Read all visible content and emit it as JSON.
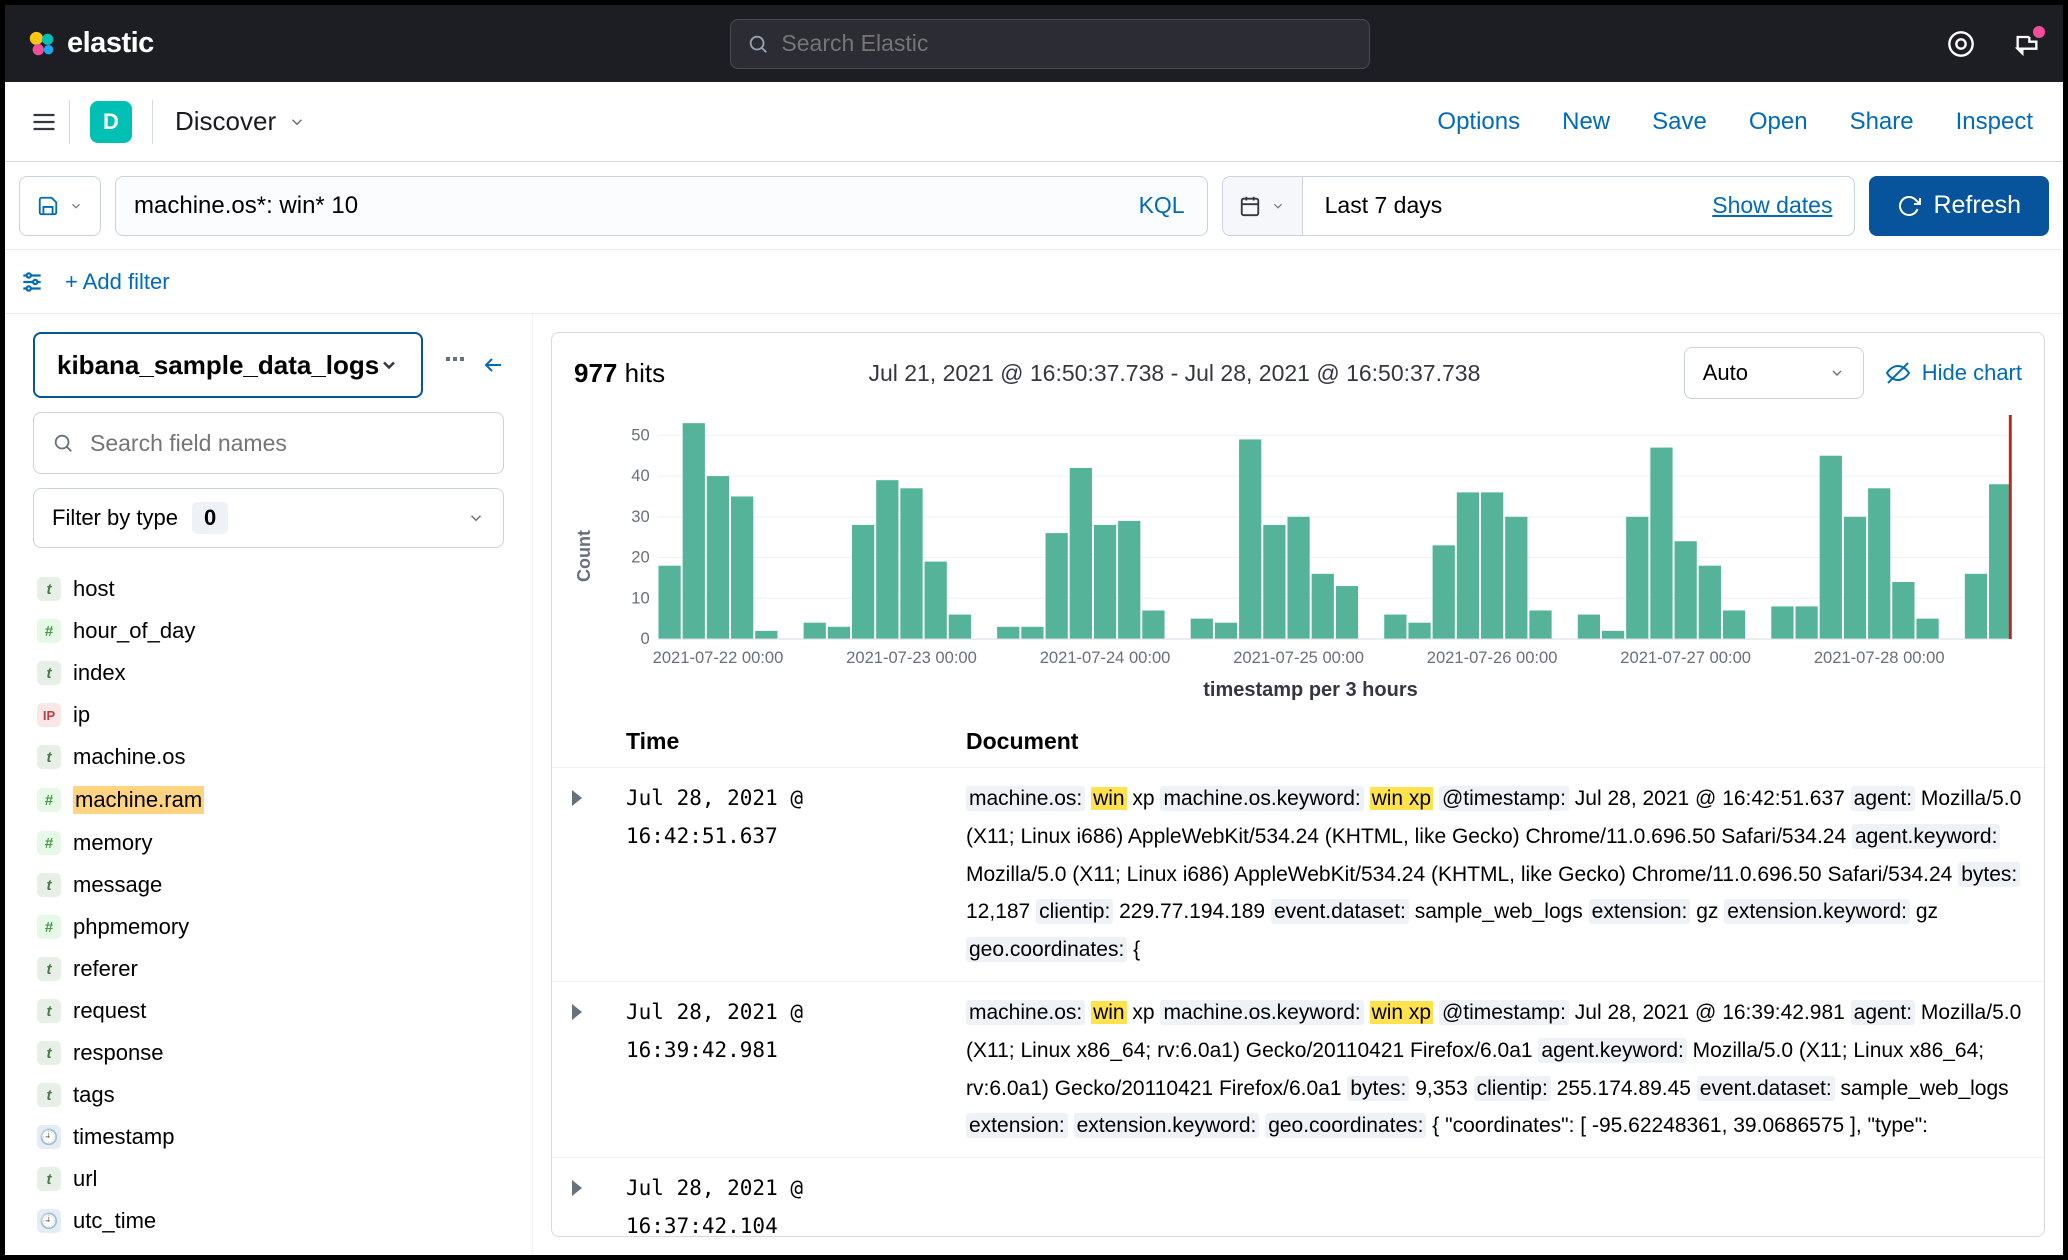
{
  "topbar": {
    "brand": "elastic",
    "search_placeholder": "Search Elastic"
  },
  "appbar": {
    "space_letter": "D",
    "breadcrumb": "Discover",
    "links": [
      "Options",
      "New",
      "Save",
      "Open",
      "Share",
      "Inspect"
    ]
  },
  "query": {
    "value": "machine.os*: win* 10",
    "lang": "KQL",
    "time_label": "Last 7 days",
    "show_dates": "Show dates",
    "refresh": "Refresh"
  },
  "filters": {
    "add_filter": "+ Add filter"
  },
  "sidebar": {
    "index_pattern": "kibana_sample_data_logs",
    "field_search_placeholder": "Search field names",
    "type_filter_label": "Filter by type",
    "type_filter_count": "0",
    "fields": [
      {
        "name": "host",
        "type": "t"
      },
      {
        "name": "hour_of_day",
        "type": "#"
      },
      {
        "name": "index",
        "type": "t"
      },
      {
        "name": "ip",
        "type": "ip"
      },
      {
        "name": "machine.os",
        "type": "t"
      },
      {
        "name": "machine.ram",
        "type": "#",
        "highlighted": true
      },
      {
        "name": "memory",
        "type": "#"
      },
      {
        "name": "message",
        "type": "t"
      },
      {
        "name": "phpmemory",
        "type": "#"
      },
      {
        "name": "referer",
        "type": "t"
      },
      {
        "name": "request",
        "type": "t"
      },
      {
        "name": "response",
        "type": "t"
      },
      {
        "name": "tags",
        "type": "t"
      },
      {
        "name": "timestamp",
        "type": "clock"
      },
      {
        "name": "url",
        "type": "t"
      },
      {
        "name": "utc_time",
        "type": "clock"
      }
    ]
  },
  "hits": {
    "count": "977",
    "label": "hits",
    "range": "Jul 21, 2021 @ 16:50:37.738 - Jul 28, 2021 @ 16:50:37.738",
    "interval": "Auto",
    "hide_chart": "Hide chart"
  },
  "chart_data": {
    "type": "bar",
    "xlabel": "timestamp per 3 hours",
    "ylabel": "Count",
    "ylim": [
      0,
      55
    ],
    "yticks": [
      0,
      10,
      20,
      30,
      40,
      50
    ],
    "categories": [
      "2021-07-21 18:00",
      "2021-07-21 21:00",
      "2021-07-22 00:00",
      "2021-07-22 03:00",
      "2021-07-22 06:00",
      "2021-07-22 09:00",
      "2021-07-22 12:00",
      "2021-07-22 15:00",
      "2021-07-22 18:00",
      "2021-07-22 21:00",
      "2021-07-23 00:00",
      "2021-07-23 03:00",
      "2021-07-23 06:00",
      "2021-07-23 09:00",
      "2021-07-23 12:00",
      "2021-07-23 15:00",
      "2021-07-23 18:00",
      "2021-07-23 21:00",
      "2021-07-24 00:00",
      "2021-07-24 03:00",
      "2021-07-24 06:00",
      "2021-07-24 09:00",
      "2021-07-24 12:00",
      "2021-07-24 15:00",
      "2021-07-24 18:00",
      "2021-07-24 21:00",
      "2021-07-25 00:00",
      "2021-07-25 03:00",
      "2021-07-25 06:00",
      "2021-07-25 09:00",
      "2021-07-25 12:00",
      "2021-07-25 15:00",
      "2021-07-25 18:00",
      "2021-07-25 21:00",
      "2021-07-26 00:00",
      "2021-07-26 03:00",
      "2021-07-26 06:00",
      "2021-07-26 09:00",
      "2021-07-26 12:00",
      "2021-07-26 15:00",
      "2021-07-26 18:00",
      "2021-07-26 21:00",
      "2021-07-27 00:00",
      "2021-07-27 03:00",
      "2021-07-27 06:00",
      "2021-07-27 09:00",
      "2021-07-27 12:00",
      "2021-07-27 15:00",
      "2021-07-27 18:00",
      "2021-07-27 21:00",
      "2021-07-28 00:00",
      "2021-07-28 03:00",
      "2021-07-28 06:00",
      "2021-07-28 09:00",
      "2021-07-28 12:00",
      "2021-07-28 15:00"
    ],
    "xticks_major": [
      "2021-07-22 00:00",
      "2021-07-23 00:00",
      "2021-07-24 00:00",
      "2021-07-25 00:00",
      "2021-07-26 00:00",
      "2021-07-27 00:00",
      "2021-07-28 00:00"
    ],
    "values": [
      18,
      53,
      40,
      35,
      2,
      0,
      4,
      3,
      28,
      39,
      37,
      19,
      6,
      0,
      3,
      3,
      26,
      42,
      28,
      29,
      7,
      0,
      5,
      4,
      49,
      28,
      30,
      16,
      13,
      0,
      6,
      4,
      23,
      36,
      36,
      30,
      7,
      0,
      6,
      2,
      30,
      47,
      24,
      18,
      7,
      0,
      8,
      8,
      45,
      30,
      37,
      14,
      5,
      0,
      16,
      38
    ]
  },
  "doc_table": {
    "columns": {
      "time": "Time",
      "document": "Document"
    },
    "rows": [
      {
        "time": "Jul 28, 2021 @ 16:42:51.637",
        "parts": [
          {
            "k": "machine.os:",
            "p": " "
          },
          {
            "hl": "win"
          },
          {
            "p": " xp "
          },
          {
            "k": "machine.os.keyword:",
            "p": " "
          },
          {
            "hl": "win xp"
          },
          {
            "p": " "
          },
          {
            "k": "@timestamp:",
            "p": " Jul 28, 2021 @ 16:42:51.637 "
          },
          {
            "k": "agent:",
            "p": " Mozilla/5.0 (X11; Linux i686) AppleWebKit/534.24 (KHTML, like Gecko) Chrome/11.0.696.50 Safari/534.24 "
          },
          {
            "k": "agent.keyword:",
            "p": " Mozilla/5.0 (X11; Linux i686) AppleWebKit/534.24 (KHTML, like Gecko) Chrome/11.0.696.50 Safari/534.24 "
          },
          {
            "k": "bytes:",
            "p": " 12,187 "
          },
          {
            "k": "clientip:",
            "p": " 229.77.194.189 "
          },
          {
            "k": "event.dataset:",
            "p": " sample_web_logs "
          },
          {
            "k": "extension:",
            "p": " gz "
          },
          {
            "k": "extension.keyword:",
            "p": " gz "
          },
          {
            "k": "geo.coordinates:",
            "p": " { "
          }
        ]
      },
      {
        "time": "Jul 28, 2021 @ 16:39:42.981",
        "parts": [
          {
            "k": "machine.os:",
            "p": " "
          },
          {
            "hl": "win"
          },
          {
            "p": " xp "
          },
          {
            "k": "machine.os.keyword:",
            "p": " "
          },
          {
            "hl": "win xp"
          },
          {
            "p": " "
          },
          {
            "k": "@timestamp:",
            "p": " Jul 28, 2021 @ 16:39:42.981 "
          },
          {
            "k": "agent:",
            "p": " Mozilla/5.0 (X11; Linux x86_64; rv:6.0a1) Gecko/20110421 Firefox/6.0a1 "
          },
          {
            "k": "agent.keyword:",
            "p": " Mozilla/5.0 (X11; Linux x86_64; rv:6.0a1) Gecko/20110421 Firefox/6.0a1 "
          },
          {
            "k": "bytes:",
            "p": " 9,353 "
          },
          {
            "k": "clientip:",
            "p": " 255.174.89.45 "
          },
          {
            "k": "event.dataset:",
            "p": " sample_web_logs "
          },
          {
            "k": "extension:",
            "p": "  "
          },
          {
            "k": "extension.keyword:",
            "p": "  "
          },
          {
            "k": "geo.coordinates:",
            "p": " { \"coordinates\": [ -95.62248361, 39.0686575 ], \"type\": "
          }
        ]
      },
      {
        "time": "Jul 28, 2021 @ 16:37:42.104",
        "parts": []
      }
    ]
  }
}
